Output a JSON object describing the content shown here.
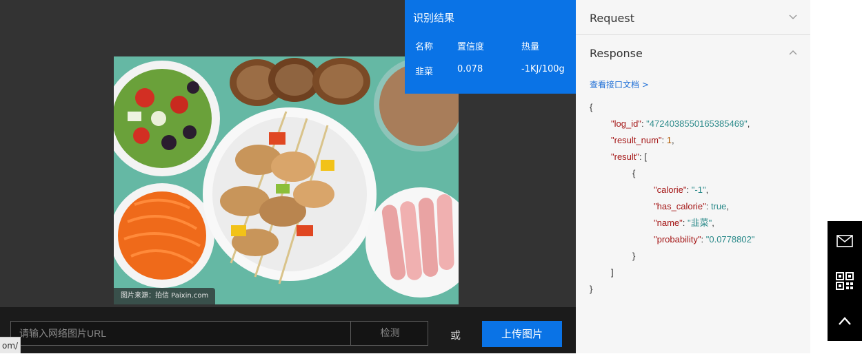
{
  "result": {
    "title": "识别结果",
    "headers": [
      "名称",
      "置信度",
      "热量"
    ],
    "row": {
      "name": "韭菜",
      "confidence": "0.078",
      "calorie": "-1KJ/100g"
    }
  },
  "photo": {
    "credit": "图片来源：拍信 Paixin.com"
  },
  "input": {
    "placeholder": "请输入网络图片URL",
    "detect_label": "检测",
    "or_text": "或",
    "upload_label": "上传图片"
  },
  "status_url": "om/",
  "api": {
    "request_label": "Request",
    "response_label": "Response",
    "doc_link": "查看接口文档 >",
    "json": {
      "open_brace": "{",
      "log_id_key": "\"log_id\"",
      "log_id_value": "\"4724038550165385469\"",
      "result_num_key": "\"result_num\"",
      "result_num_value": "1",
      "result_key": "\"result\"",
      "result_open": ": [",
      "item_open": "{",
      "calorie_key": "\"calorie\"",
      "calorie_value": "\"-1\"",
      "has_calorie_key": "\"has_calorie\"",
      "has_calorie_value": "true",
      "name_key": "\"name\"",
      "name_value": "\"韭菜\"",
      "probability_key": "\"probability\"",
      "probability_value": "\"0.0778802\"",
      "item_close": "}",
      "array_close": "]",
      "close_brace": "}"
    }
  },
  "float_bar": {
    "icons": [
      "mail-icon",
      "qr-code-icon",
      "chevron-up-icon"
    ]
  },
  "colors": {
    "accent": "#0a73e6",
    "stage": "#333333",
    "panel": "#f6f6f6"
  }
}
